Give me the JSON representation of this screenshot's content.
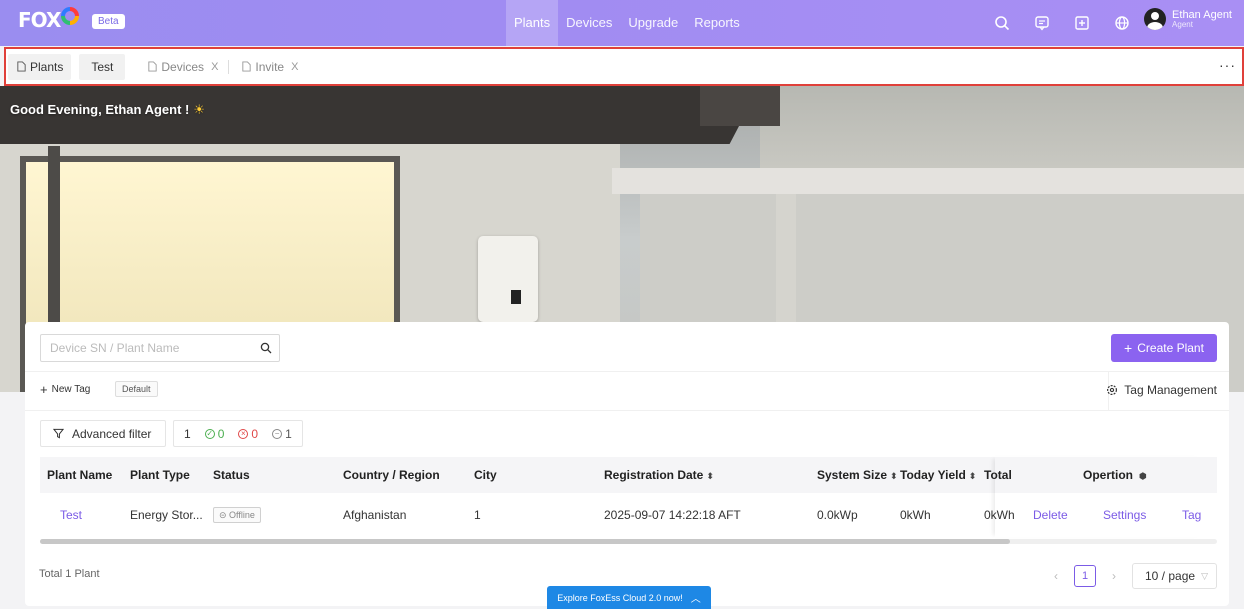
{
  "header": {
    "logo_text": "FOX",
    "beta_label": "Beta",
    "nav": [
      {
        "label": "Plants",
        "active": true
      },
      {
        "label": "Devices",
        "active": false
      },
      {
        "label": "Upgrade",
        "active": false
      },
      {
        "label": "Reports",
        "active": false
      }
    ],
    "icons": [
      "search-icon",
      "message-icon",
      "add-box-icon",
      "globe-icon"
    ],
    "user": {
      "name": "Ethan Agent",
      "role": "Agent"
    }
  },
  "tabs": [
    {
      "label": "Plants",
      "style": "boxed",
      "closable": false
    },
    {
      "label": "Test",
      "style": "boxed",
      "closable": false
    },
    {
      "label": "Devices",
      "style": "plain",
      "closable": true
    },
    {
      "label": "Invite",
      "style": "plain",
      "closable": true
    }
  ],
  "tabs_close_glyph": "X",
  "more_glyph": "···",
  "hero": {
    "greeting": "Good Evening, Ethan Agent !"
  },
  "toolbar": {
    "search_placeholder": "Device SN / Plant Name",
    "create_label": "Create Plant",
    "new_tag_label": "New Tag",
    "default_tag": "Default",
    "tag_management_label": "Tag Management"
  },
  "filters": {
    "advanced_label": "Advanced filter",
    "total": "1",
    "online": "0",
    "fault": "0",
    "offline": "1"
  },
  "table": {
    "headers": {
      "plant_name": "Plant Name",
      "plant_type": "Plant Type",
      "status": "Status",
      "country": "Country / Region",
      "city": "City",
      "reg_date": "Registration Date",
      "system_size": "System Size",
      "today_yield": "Today Yield",
      "total_yield": "Total '",
      "operation": "Opertion"
    },
    "rows": [
      {
        "plant_name": "Test",
        "plant_type": "Energy Stor...",
        "status": "Offline",
        "country": "Afghanistan",
        "city": "1",
        "reg_date": "2025-09-07 14:22:18 AFT",
        "system_size": "0.0kWp",
        "today_yield": "0kWh",
        "total_yield": "0kWh",
        "actions": {
          "delete": "Delete",
          "settings": "Settings",
          "tag": "Tag"
        }
      }
    ]
  },
  "footer": {
    "total_text": "Total 1 Plant",
    "current_page": "1",
    "page_size": "10 / page",
    "explore_banner": "Explore FoxEss Cloud 2.0 now!"
  },
  "colors": {
    "header_bg": "#a08cf2",
    "accent": "#8b63f0",
    "link": "#7b5be6",
    "tabbar_border": "#e0403a",
    "explore_bg": "#1e88e5"
  }
}
